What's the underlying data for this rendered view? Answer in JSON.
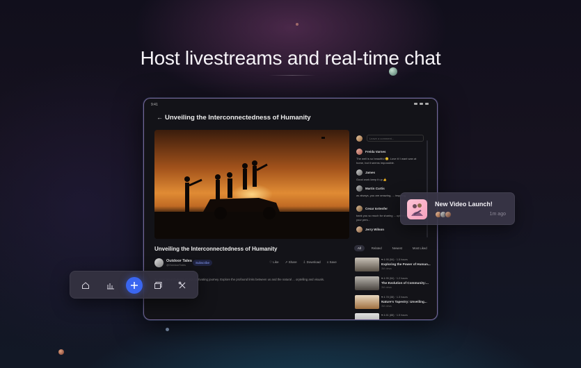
{
  "headline": "Host livestreams and real-time chat",
  "tablet": {
    "status_time": "9:41",
    "page_title": "Unveiling the Interconnectedness of Humanity",
    "video_title": "Unveiling the Interconnectedness of Humanity",
    "channel": {
      "name": "Outdoor Tales",
      "handle": "@OutdoorTales",
      "subscribe_label": "Subscribe"
    },
    "actions": [
      "Like",
      "Share",
      "Download",
      "Save"
    ],
    "description": "an interconnectedness in our captivating journey. Explore the profound links between us and the natural ... orytelling and visuals.",
    "chat": {
      "input_placeholder": "Leave a comment...",
      "messages": [
        {
          "name": "Freida Varnes",
          "text": "The well is so beautiful 🙂. Love it! I want wan at home, but it seems impossible."
        },
        {
          "name": "James",
          "text": "Good work keep it up 👍"
        },
        {
          "name": "Martin Curtis",
          "text": "as always, you are amazing, ... inspiring."
        },
        {
          "name": "Cesar Iortenfer",
          "text": "bank you so much for sharing ... uplifting to hear how your pers..."
        },
        {
          "name": "Jerry Wilson",
          "text": ""
        }
      ]
    },
    "filters": [
      "All",
      "Related",
      "Newest",
      "Most Liked"
    ],
    "recommendations": [
      {
        "meta": "♥ 4.95 (54) · 1.5 hours",
        "title": "Exploring the Power of Human...",
        "sub": "3M views"
      },
      {
        "meta": "♥ 4.95 (54) · 1.2 hours",
        "title": "The Evolution of Community:...",
        "sub": "3M views"
      },
      {
        "meta": "♥ 4.78 (38) · 1.3 hours",
        "title": "Nature's Tapestry: Unveiling...",
        "sub": "3M views"
      },
      {
        "meta": "♥ 4.61 (88) · 1.5 hours",
        "title": "",
        "sub": ""
      }
    ]
  },
  "toast": {
    "title": "New Video Launch!",
    "time": "1m ago"
  },
  "dock": {
    "items": [
      {
        "icon": "home-icon"
      },
      {
        "icon": "chart-icon"
      },
      {
        "icon": "plus-icon"
      },
      {
        "icon": "gallery-icon"
      },
      {
        "icon": "tools-icon"
      }
    ]
  },
  "colors": {
    "accent": "#3a66f0",
    "toast_bg": "#3a3648",
    "sunset": "#e08b34"
  }
}
